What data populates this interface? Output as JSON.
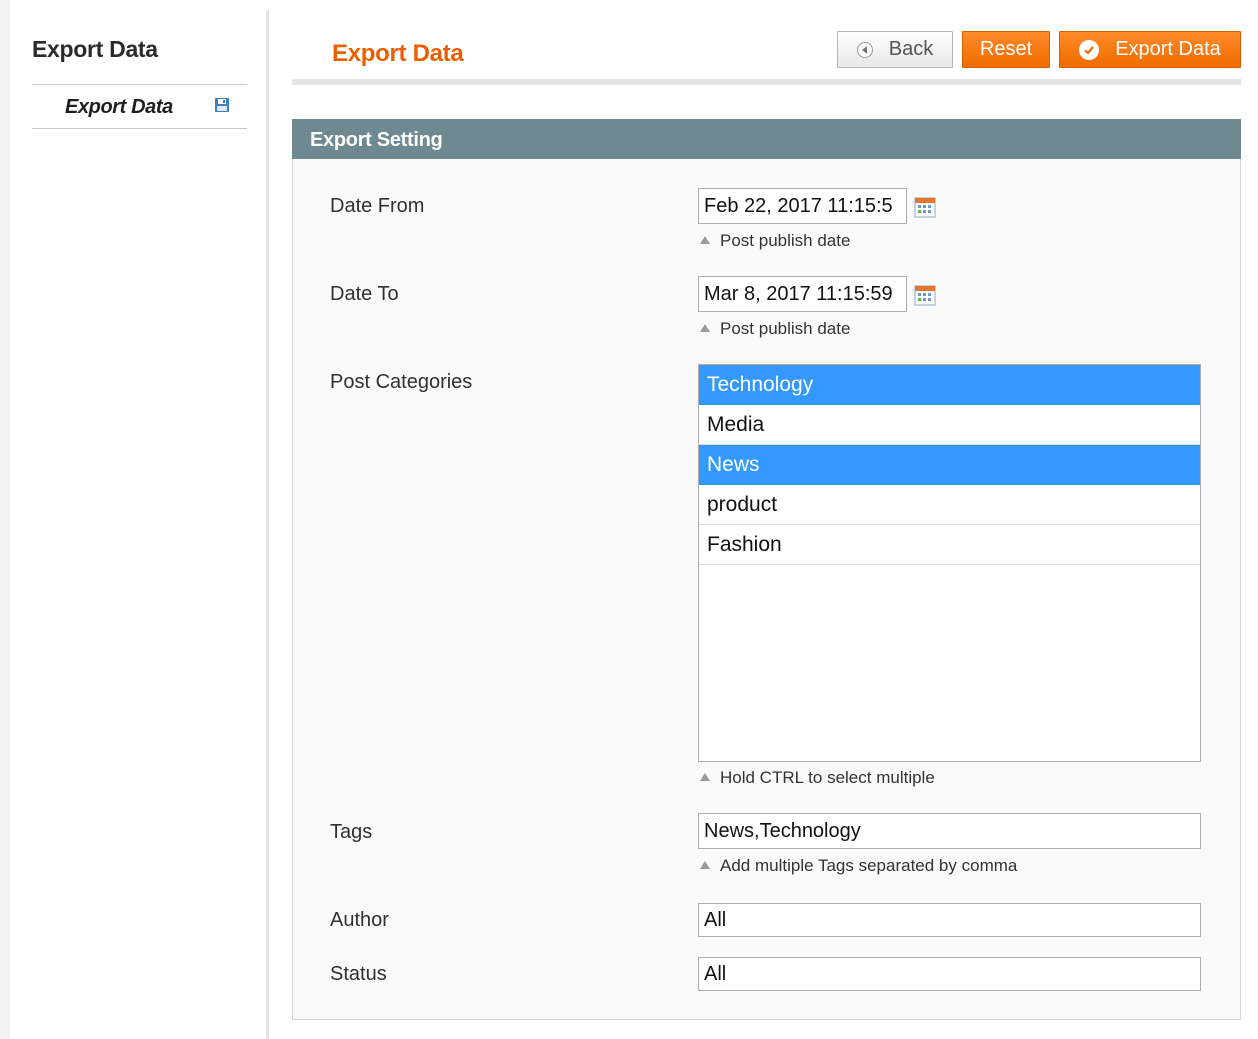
{
  "sidebar": {
    "title": "Export Data",
    "items": [
      {
        "label": "Export Data",
        "icon": "floppy-disk-icon"
      }
    ]
  },
  "header": {
    "title": "Export Data",
    "buttons": {
      "back": "Back",
      "reset": "Reset",
      "export": "Export Data"
    }
  },
  "fieldset": {
    "title": "Export Setting",
    "date_from": {
      "label": "Date From",
      "value": "Feb 22, 2017 11:15:5",
      "note": "Post publish date"
    },
    "date_to": {
      "label": "Date To",
      "value": "Mar 8, 2017 11:15:59",
      "note": "Post publish date"
    },
    "categories": {
      "label": "Post Categories",
      "options": [
        {
          "label": "Technology",
          "selected": true
        },
        {
          "label": "Media",
          "selected": false
        },
        {
          "label": "News",
          "selected": true
        },
        {
          "label": "product",
          "selected": false
        },
        {
          "label": "Fashion",
          "selected": false
        }
      ],
      "note": "Hold CTRL to select multiple"
    },
    "tags": {
      "label": "Tags",
      "value": "News,Technology",
      "note": "Add multiple Tags separated by comma"
    },
    "author": {
      "label": "Author",
      "value": "All"
    },
    "status": {
      "label": "Status",
      "value": "All"
    }
  },
  "colors": {
    "accent": "#eb5e00",
    "button_orange": "#f47b14",
    "fieldset_header": "#6f8992",
    "selected_option": "#3399ff"
  }
}
